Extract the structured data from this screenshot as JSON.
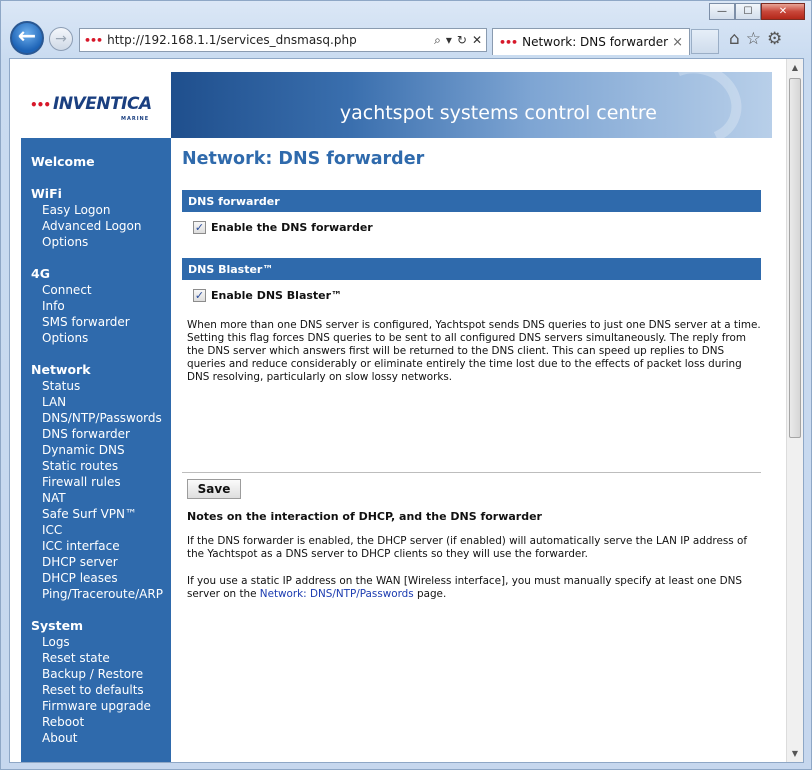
{
  "browser": {
    "url": "http://192.168.1.1/services_dnsmasq.php",
    "tab_title": "Network: DNS forwarder",
    "tab_close": "×",
    "address_icons": [
      "search-icon",
      "refresh-icon",
      "stop-icon"
    ],
    "window_controls": {
      "minimize": "—",
      "maximize": "☐",
      "close": "✕"
    }
  },
  "header": {
    "logo_text": "INVENTICA",
    "logo_sub": "MARINE",
    "banner_text": "yachtspot systems control centre"
  },
  "sidebar": {
    "welcome": "Welcome",
    "sections": [
      {
        "title": "WiFi",
        "items": [
          "Easy Logon",
          "Advanced Logon",
          "Options"
        ]
      },
      {
        "title": "4G",
        "items": [
          "Connect",
          "Info",
          "SMS forwarder",
          "Options"
        ]
      },
      {
        "title": "Network",
        "items": [
          "Status",
          "LAN",
          "DNS/NTP/Passwords",
          "DNS forwarder",
          "Dynamic DNS",
          "Static routes",
          "Firewall rules",
          "NAT",
          "Safe Surf VPN™",
          "ICC",
          "ICC interface",
          "DHCP server",
          "DHCP leases",
          "Ping/Traceroute/ARP"
        ]
      },
      {
        "title": "System",
        "items": [
          "Logs",
          "Reset state",
          "Backup / Restore",
          "Reset to defaults",
          "Firmware upgrade",
          "Reboot",
          "About"
        ]
      }
    ]
  },
  "main": {
    "title": "Network: DNS forwarder",
    "dns_forwarder": {
      "section_title": "DNS forwarder",
      "checkbox_label": "Enable the DNS forwarder",
      "checked": true
    },
    "dns_blaster": {
      "section_title": "DNS Blaster™",
      "checkbox_label": "Enable DNS Blaster™",
      "checked": true,
      "description": "When more than one DNS server is configured, Yachtspot sends DNS queries to just one DNS server at a time. Setting this flag forces DNS queries to be sent to all configured DNS servers simultaneously. The reply from the DNS server which answers first will be returned to the DNS client. This can speed up replies to DNS queries and reduce considerably or eliminate entirely the time lost due to the effects of packet loss during DNS resolving, particularly on slow lossy networks."
    },
    "save_label": "Save",
    "notes": {
      "heading": "Notes on the interaction of DHCP, and the DNS forwarder",
      "para1": "If the DNS forwarder is enabled, the DHCP server (if enabled) will automatically serve the LAN IP address of the Yachtspot as a DNS server to DHCP clients so they will use the forwarder.",
      "para2_before": "If you use a static IP address on the WAN [Wireless interface], you must manually specify at least one DNS server on the ",
      "para2_link": "Network: DNS/NTP/Passwords",
      "para2_after": " page."
    }
  }
}
